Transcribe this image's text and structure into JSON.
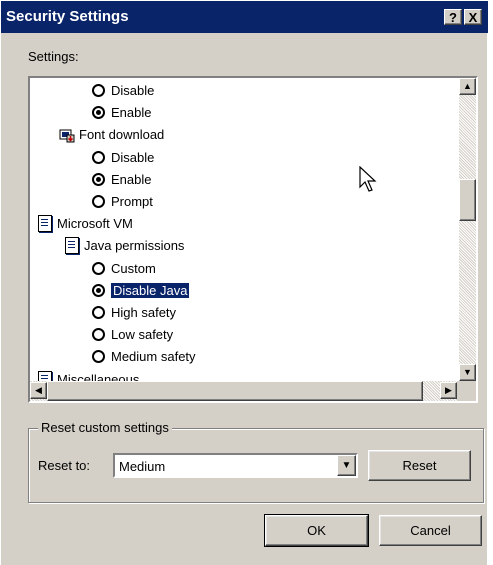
{
  "window": {
    "title": "Security Settings",
    "help_label": "?",
    "close_label": "X"
  },
  "settings_label": "Settings:",
  "tree": {
    "rows": [
      {
        "type": "radio",
        "label": "Disable",
        "checked": false
      },
      {
        "type": "radio",
        "label": "Enable",
        "checked": true
      },
      {
        "type": "category",
        "icon": "font-download-icon",
        "label": "Font download"
      },
      {
        "type": "radio",
        "label": "Disable",
        "checked": false
      },
      {
        "type": "radio",
        "label": "Enable",
        "checked": true
      },
      {
        "type": "radio",
        "label": "Prompt",
        "checked": false
      },
      {
        "type": "category",
        "icon": "document-icon",
        "label": "Microsoft VM"
      },
      {
        "type": "category",
        "icon": "document-icon",
        "label": "Java permissions"
      },
      {
        "type": "radio",
        "label": "Custom",
        "checked": false
      },
      {
        "type": "radio",
        "label": "Disable Java",
        "checked": true,
        "selected": true
      },
      {
        "type": "radio",
        "label": "High safety",
        "checked": false
      },
      {
        "type": "radio",
        "label": "Low safety",
        "checked": false
      },
      {
        "type": "radio",
        "label": "Medium safety",
        "checked": false
      },
      {
        "type": "category",
        "icon": "document-icon",
        "label": "Miscellaneous"
      }
    ]
  },
  "reset_group": {
    "title": "Reset custom settings",
    "reset_to_label": "Reset to:",
    "selected_level": "Medium",
    "reset_button": "Reset"
  },
  "footer": {
    "ok": "OK",
    "cancel": "Cancel"
  },
  "colors": {
    "titlebar": "#0a246a",
    "face": "#d4d0c8",
    "selection": "#0a246a"
  }
}
